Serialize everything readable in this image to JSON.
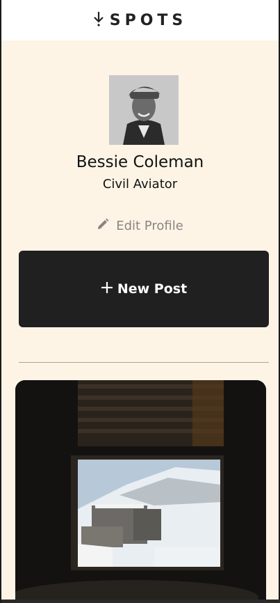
{
  "header": {
    "logo_text": "SPOTS"
  },
  "profile": {
    "name": "Bessie Coleman",
    "title": "Civil Aviator",
    "edit_label": "Edit Profile"
  },
  "actions": {
    "new_post_label": "New Post"
  },
  "colors": {
    "background": "#fdf4e6",
    "header_bg": "#ffffff",
    "button_bg": "#202020",
    "muted_text": "#8a8580"
  },
  "icons": [
    "logo-icon",
    "pencil-icon",
    "plus-icon"
  ]
}
